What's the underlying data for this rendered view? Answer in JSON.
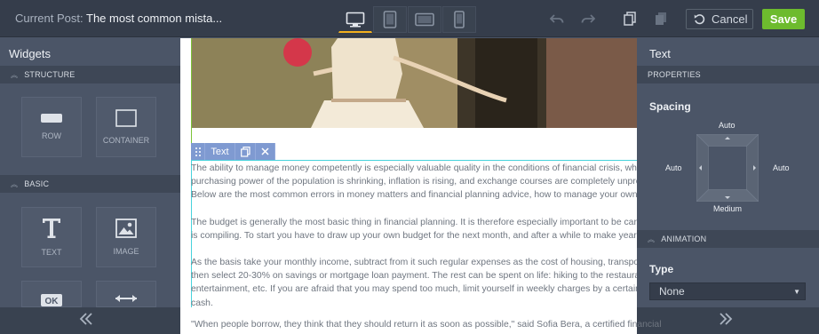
{
  "header": {
    "current_post_label": "Current Post:",
    "post_title": "The most common mista...",
    "devices": [
      "desktop-icon",
      "tablet-portrait-icon",
      "tablet-landscape-icon",
      "phone-icon"
    ],
    "active_device": "desktop",
    "cancel_label": "Cancel",
    "save_label": "Save",
    "accent_color": "#f2b01e",
    "save_color": "#6dbb2e"
  },
  "widgets_panel": {
    "title": "Widgets",
    "sections": [
      {
        "label": "STRUCTURE",
        "items": [
          "ROW",
          "CONTAINER"
        ]
      },
      {
        "label": "BASIC",
        "items": [
          "TEXT",
          "IMAGE"
        ]
      }
    ]
  },
  "canvas": {
    "toolbar_label": "Text",
    "selection_color": "#48d3dc",
    "paragraphs": [
      [
        "The ability to manage money competently is especially valuable quality in the conditions of financial crisis, when th",
        "purchasing power of the population is shrinking, inflation is rising, and exchange courses are completely unpredict",
        "Below are the most common errors in money matters and financial planning advice, how to manage your own finances p"
      ],
      [
        "The budget is generally the most basic thing in financial planning. It is therefore especially important to be careful v",
        "is compiling. To start you have to draw up your own budget for the next month, and after a while to make year budg"
      ],
      [
        "As the basis take your monthly income, subtract from it such regular expenses as the cost of housing, transportatio",
        "then select 20-30% on savings or mortgage loan payment. The rest can be spent on life: hiking to the restaurant,",
        "entertainment, etc. If you are afraid that you may spend too much, limit yourself in weekly charges by a certain am",
        "cash."
      ]
    ],
    "last_line": "\"When people borrow, they think that they should return it as soon as possible,\" said Sofia Bera, a certified financial"
  },
  "properties_panel": {
    "title": "Text",
    "properties_label": "PROPERTIES",
    "spacing_label": "Spacing",
    "spacing": {
      "top": "Auto",
      "left": "Auto",
      "right": "Auto",
      "bottom": "Medium"
    },
    "animation_label": "ANIMATION",
    "type_label": "Type",
    "type_value": "None"
  }
}
